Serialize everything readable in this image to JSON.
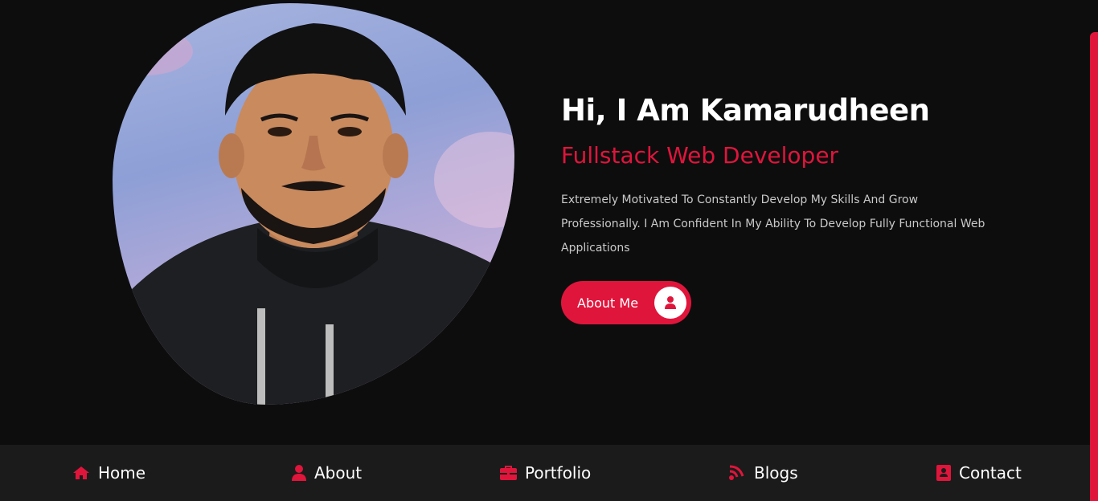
{
  "hero": {
    "greeting": "Hi, I Am Kamarudheen",
    "role": "Fullstack Web Developer",
    "description": "Extremely Motivated To Constantly Develop My Skills And Grow Professionally. I Am Confident In My Ability To Develop Fully Functional Web Applications",
    "about_button_label": "About Me",
    "about_button_icon": "user-icon"
  },
  "nav": {
    "items": [
      {
        "label": "Home",
        "icon": "home-icon"
      },
      {
        "label": "About",
        "icon": "user-icon"
      },
      {
        "label": "Portfolio",
        "icon": "briefcase-icon"
      },
      {
        "label": "Blogs",
        "icon": "blog-icon"
      },
      {
        "label": "Contact",
        "icon": "address-book-icon"
      }
    ]
  },
  "colors": {
    "accent": "#e0153b",
    "background": "#0d0d0e",
    "nav_background": "#1b1b1b",
    "text": "#ffffff",
    "muted_text": "#c9c9c9"
  }
}
